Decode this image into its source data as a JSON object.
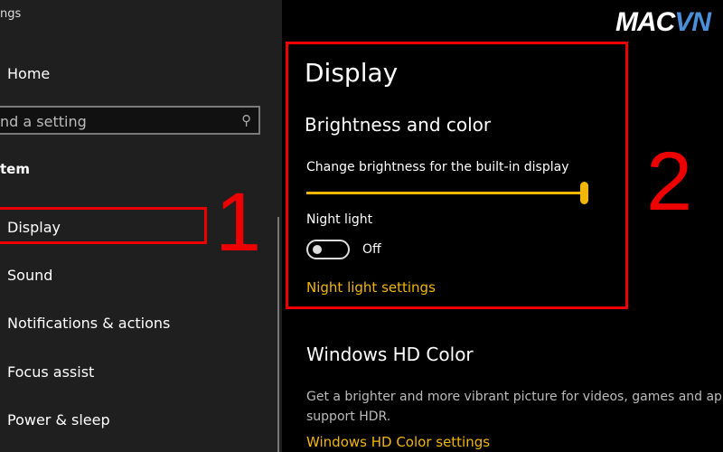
{
  "window": {
    "title": "ngs"
  },
  "sidebar": {
    "home": "Home",
    "search_placeholder": "nd a setting",
    "section": "tem",
    "items": [
      {
        "label": "Display"
      },
      {
        "label": "Sound"
      },
      {
        "label": "Notifications & actions"
      },
      {
        "label": "Focus assist"
      },
      {
        "label": "Power & sleep"
      }
    ]
  },
  "annotations": {
    "one": "1",
    "two": "2",
    "highlight_color": "#e00000"
  },
  "logo": {
    "part1": "MAC",
    "part2": "VN"
  },
  "main": {
    "title": "Display",
    "brightness": {
      "heading": "Brightness and color",
      "label": "Change brightness for the built-in display",
      "value_percent": 100
    },
    "night_light": {
      "label": "Night light",
      "state": "Off",
      "settings_link": "Night light settings"
    },
    "hdr": {
      "heading": "Windows HD Color",
      "description_line1": "Get a brighter and more vibrant picture for videos, games and apps",
      "description_line2": "support HDR.",
      "settings_link": "Windows HD Color settings"
    }
  },
  "colors": {
    "accent": "#f2b705",
    "sidebar_bg": "#1f1f1f",
    "main_bg": "#000000"
  }
}
